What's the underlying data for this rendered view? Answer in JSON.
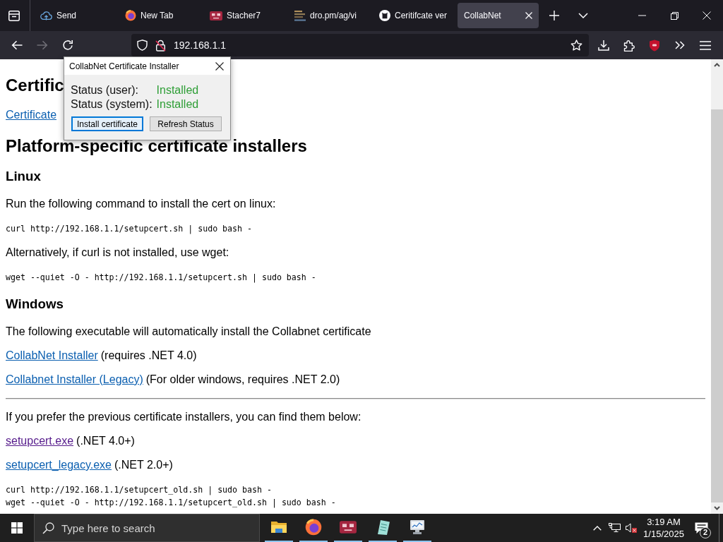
{
  "browser": {
    "tabs": [
      {
        "label": "Send",
        "selected": false
      },
      {
        "label": "New Tab",
        "selected": false
      },
      {
        "label": "Stacher7",
        "selected": false
      },
      {
        "label": "dro.pm/ag/vi",
        "selected": false
      },
      {
        "label": "Ceritifcate ver",
        "selected": false
      },
      {
        "label": "CollabNet",
        "selected": true
      }
    ],
    "forward_disabled": true,
    "address": "192.168.1.1"
  },
  "dialog": {
    "title": "CollabNet Certificate Installer",
    "statuses": [
      {
        "label": "Status (user):",
        "value": "Installed"
      },
      {
        "label": "Status (system):",
        "value": "Installed"
      }
    ],
    "buttons": [
      {
        "label": "Install certificate",
        "focused": true
      },
      {
        "label": "Refresh Status",
        "focused": false
      }
    ]
  },
  "page": {
    "blocks": [
      {
        "kind": "h1",
        "text": "Certific"
      },
      {
        "kind": "p",
        "link": "Certificate",
        "visited": false
      },
      {
        "kind": "h1",
        "text": "Platform-specific certificate installers"
      },
      {
        "kind": "h2",
        "text": "Linux"
      },
      {
        "kind": "p",
        "text": "Run the following command to install the cert on linux:"
      },
      {
        "kind": "code",
        "lines": [
          "curl http://192.168.1.1/setupcert.sh | sudo bash -"
        ]
      },
      {
        "kind": "p",
        "text": "Alternatively, if curl is not installed, use wget:"
      },
      {
        "kind": "code",
        "lines": [
          "wget --quiet -O - http://192.168.1.1/setupcert.sh | sudo bash -"
        ]
      },
      {
        "kind": "h2",
        "text": "Windows"
      },
      {
        "kind": "p",
        "text": "The following executable will automatically install the Collabnet certificate"
      },
      {
        "kind": "p",
        "link": "CollabNet Installer",
        "visited": false,
        "text": "(requires .NET 4.0)"
      },
      {
        "kind": "p",
        "link": "Collabnet Installer (Legacy)",
        "visited": false,
        "text": "(For older windows, requires .NET 2.0)"
      },
      {
        "kind": "rule"
      },
      {
        "kind": "p",
        "text": "If you prefer the previous certificate installers, you can find them below:"
      },
      {
        "kind": "p",
        "link": "setupcert.exe",
        "visited": true,
        "text": "(.NET 4.0+)"
      },
      {
        "kind": "p",
        "link": "setupcert_legacy.exe",
        "visited": false,
        "text": "(.NET 2.0+)"
      },
      {
        "kind": "code",
        "lines": [
          "curl http://192.168.1.1/setupcert_old.sh | sudo bash -",
          "wget --quiet -O - http://192.168.1.1/setupcert_old.sh | sudo bash -"
        ]
      }
    ]
  },
  "taskbar": {
    "search": {
      "placeholder": "Type here to search"
    },
    "apps": [
      {
        "running": true
      },
      {
        "running": true
      },
      {
        "running": true
      },
      {
        "running": true
      },
      {
        "running": true
      }
    ],
    "volume_muted": true,
    "clock": {
      "time": "3:19 AM",
      "date": "1/15/2025"
    },
    "notifications": "2"
  }
}
